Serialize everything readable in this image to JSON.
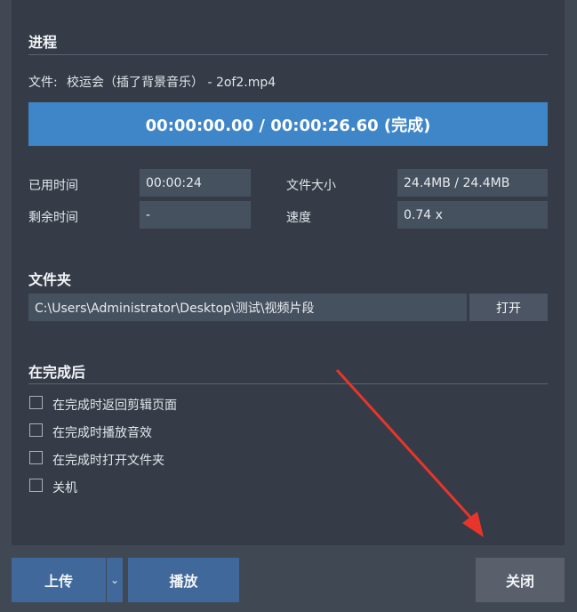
{
  "progress": {
    "title": "进程",
    "file_label": "文件:",
    "file_name": "校运会（插了背景音乐） - 2of2.mp4",
    "bar_text": "00:00:00.00 / 00:00:26.60 (完成)",
    "stats": {
      "elapsed_label": "已用时间",
      "elapsed_value": "00:00:24",
      "remaining_label": "剩余时间",
      "remaining_value": "-",
      "filesize_label": "文件大小",
      "filesize_value": "24.4MB / 24.4MB",
      "speed_label": "速度",
      "speed_value": "0.74 x"
    }
  },
  "folder": {
    "title": "文件夹",
    "path": "C:\\Users\\Administrator\\Desktop\\测试\\视频片段",
    "open_label": "打开"
  },
  "after": {
    "title": "在完成后",
    "options": [
      "在完成时返回剪辑页面",
      "在完成时播放音效",
      "在完成时打开文件夹",
      "关机"
    ]
  },
  "footer": {
    "upload_label": "上传",
    "play_label": "播放",
    "close_label": "关闭",
    "dropdown_icon": "chevron-down-icon"
  },
  "colors": {
    "progress_bar": "#3f86c9",
    "primary_button": "#40689a",
    "panel": "#353c47",
    "window": "#404854"
  }
}
